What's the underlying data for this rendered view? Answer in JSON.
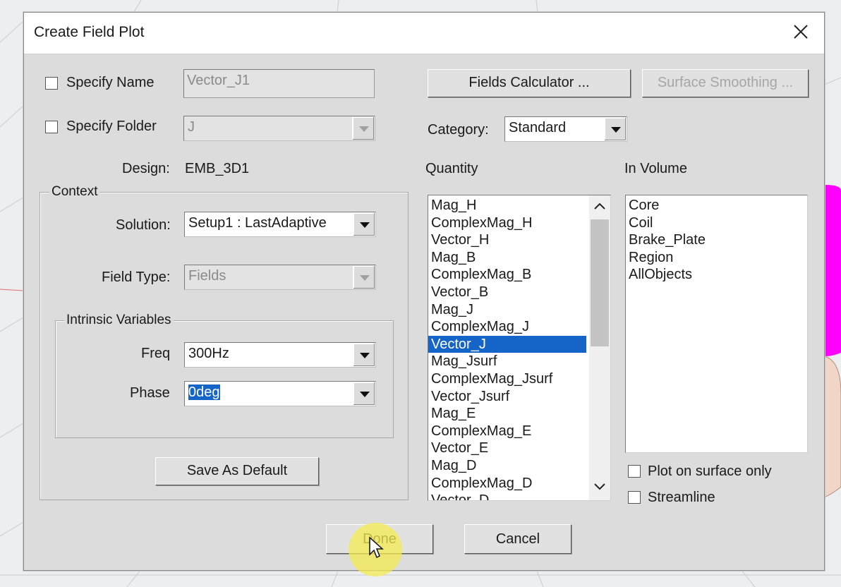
{
  "dialog": {
    "title": "Create Field Plot",
    "close_icon": "close-icon"
  },
  "left": {
    "specify_name_label": "Specify Name",
    "specify_name_checked": false,
    "name_value": "Vector_J1",
    "specify_folder_label": "Specify Folder",
    "specify_folder_checked": false,
    "folder_value": "J",
    "design_label": "Design:",
    "design_value": "EMB_3D1",
    "context": {
      "title": "Context",
      "solution_label": "Solution:",
      "solution_value": "Setup1 : LastAdaptive",
      "field_type_label": "Field Type:",
      "field_type_value": "Fields"
    },
    "intrinsic": {
      "title": "Intrinsic Variables",
      "freq_label": "Freq",
      "freq_value": "300Hz",
      "phase_label": "Phase",
      "phase_value": "0deg"
    },
    "save_default_label": "Save As Default"
  },
  "right": {
    "fields_calculator_label": "Fields Calculator ...",
    "surface_smoothing_label": "Surface Smoothing ...",
    "category_label": "Category:",
    "category_value": "Standard",
    "quantity_label": "Quantity",
    "in_volume_label": "In Volume",
    "quantities": [
      "Mag_H",
      "ComplexMag_H",
      "Vector_H",
      "Mag_B",
      "ComplexMag_B",
      "Vector_B",
      "Mag_J",
      "ComplexMag_J",
      "Vector_J",
      "Mag_Jsurf",
      "ComplexMag_Jsurf",
      "Vector_Jsurf",
      "Mag_E",
      "ComplexMag_E",
      "Vector_E",
      "Mag_D",
      "ComplexMag_D",
      "Vector_D"
    ],
    "selected_quantity": "Vector_J",
    "volumes": [
      "Core",
      "Coil",
      "Brake_Plate",
      "Region",
      "AllObjects"
    ],
    "plot_surface_only_label": "Plot on surface only",
    "streamline_label": "Streamline"
  },
  "footer": {
    "done_label": "Done",
    "cancel_label": "Cancel"
  },
  "colors": {
    "selection": "#1565c8",
    "highlight": "#f5eb50",
    "magenta_object": "#ff00ff"
  }
}
